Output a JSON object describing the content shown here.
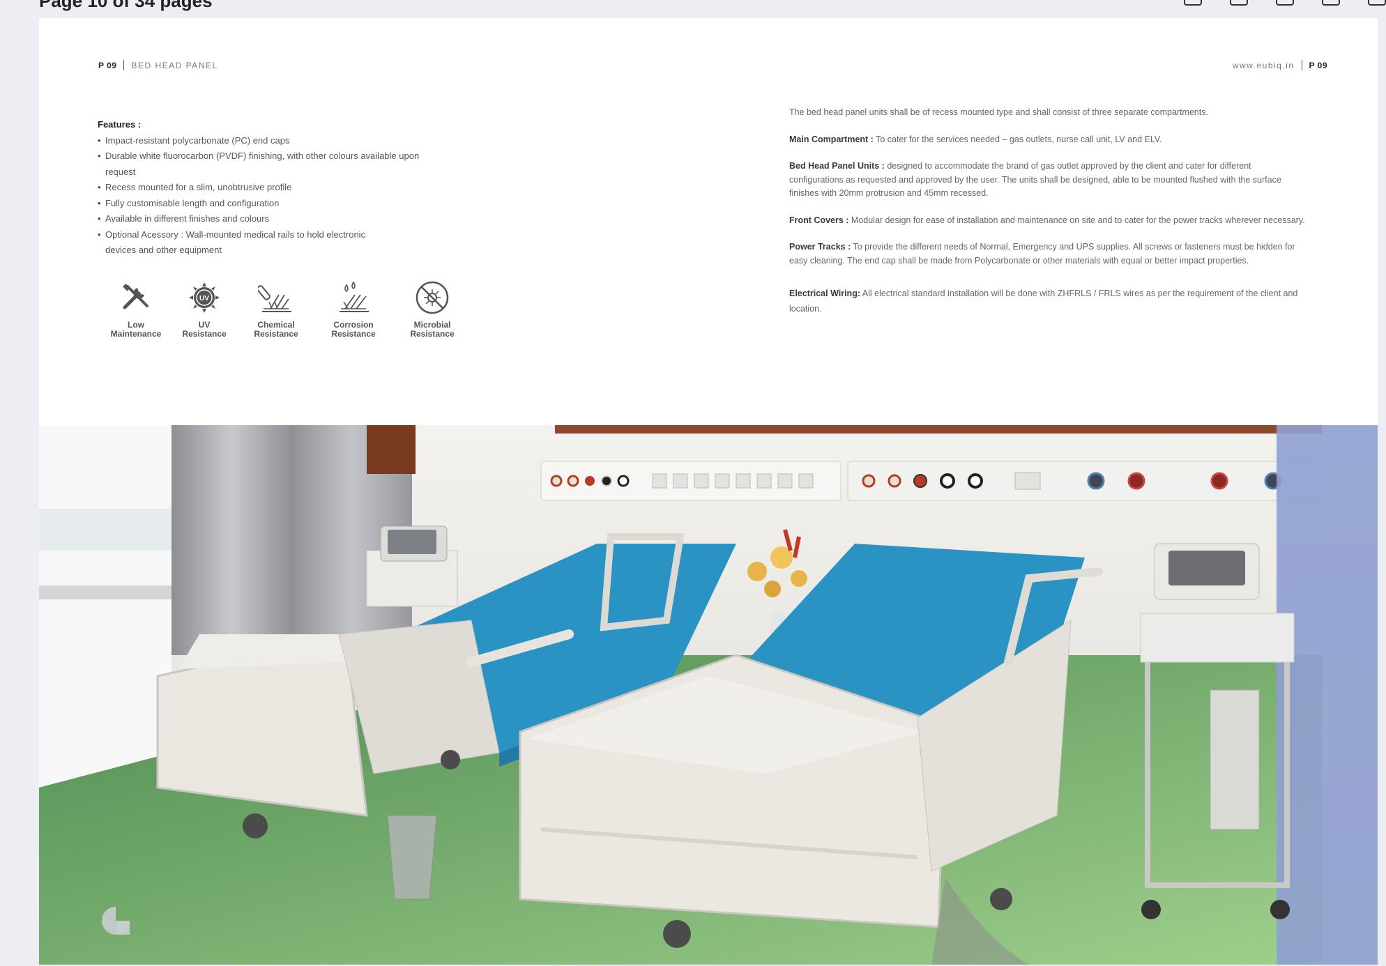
{
  "viewer": {
    "title": "Page 10 of 34 pages"
  },
  "header": {
    "left_page": "P 09",
    "left_title": "BED HEAD PANEL",
    "right_url": "www.eubiq.in",
    "right_page": "P 09"
  },
  "features": {
    "title": "Features :",
    "items": [
      "Impact-resistant polycarbonate (PC) end caps",
      "Durable white fluorocarbon (PVDF) finishing, with other colours available upon request",
      "Recess mounted for a slim, unobtrusive profile",
      "Fully customisable length and configuration",
      "Available in different finishes and colours",
      "Optional Acessory : Wall-mounted medical rails to hold electronic devices and other equipment"
    ]
  },
  "properties": [
    {
      "icon": "tools-icon",
      "label": "Low\nMaintenance"
    },
    {
      "icon": "uv-icon",
      "label": "UV\nResistance"
    },
    {
      "icon": "chemical-icon",
      "label": "Chemical\nResistance"
    },
    {
      "icon": "corrosion-icon",
      "label": "Corrosion\nResistance"
    },
    {
      "icon": "microbial-icon",
      "label": "Microbial\nResistance"
    }
  ],
  "specs": {
    "intro": "The bed head panel units shall be of recess mounted type and shall consist of three separate compartments.",
    "main_label": "Main Compartment :",
    "main_text": " To cater for the services needed – gas outlets, nurse call unit, LV and ELV.",
    "units_label": "Bed Head Panel Units :",
    "units_text": " designed to accommodate the brand of gas outlet approved by the client and cater for different configurations as requested and approved by the user. The units shall be designed, able to be mounted flushed with the surface finishes with 20mm protrusion and 45mm recessed.",
    "covers_label": "Front Covers :",
    "covers_text": " Modular design for ease of installation and maintenance on site and to cater for the power tracks wherever necessary.",
    "power_label": "Power Tracks :",
    "power_text": " To provide the different needs of Normal, Emergency and UPS supplies. All screws or fasteners must be hidden for easy cleaning. The end cap shall be made from Polycarbonate or other materials with equal or better impact properties.",
    "wiring_label": "Electrical Wiring:",
    "wiring_text": " All electrical standard installation will be done with ZHFRLS / FRLS wires as per the requirement of the client and location."
  },
  "colors": {
    "mattress": "#2b93c4",
    "floor": "#5e9a5c",
    "bed_frame": "#e8e6df",
    "wood": "#8b4a2e",
    "side_panel": "#8f9fd0"
  }
}
